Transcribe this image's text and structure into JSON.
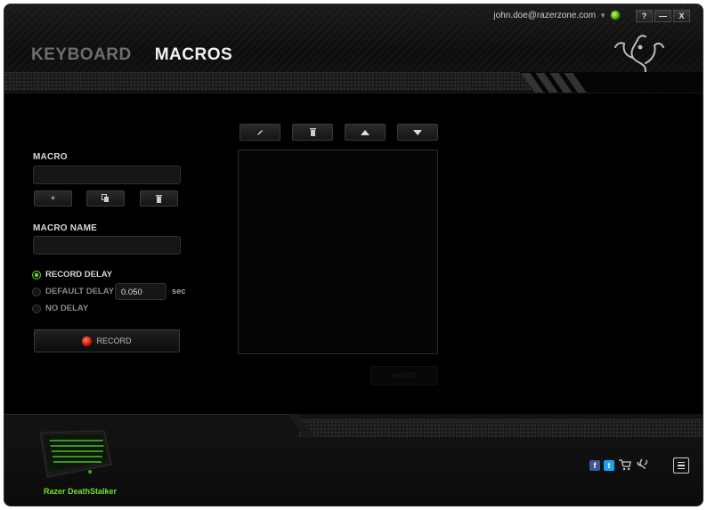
{
  "account": {
    "email": "john.doe@razerzone.com",
    "dropdown_icon": "triangle-down-icon",
    "status_color": "#44c800"
  },
  "window_controls": {
    "help": "?",
    "minimize": "—",
    "close": "X"
  },
  "tabs": [
    {
      "label": "KEYBOARD",
      "active": false
    },
    {
      "label": "MACROS",
      "active": true
    }
  ],
  "macro_panel": {
    "macro_label": "MACRO",
    "macro_value": "",
    "add_button": "+",
    "copy_icon": "copy-icon",
    "delete_icon": "trash-icon",
    "macro_name_label": "MACRO NAME",
    "macro_name_value": ""
  },
  "delay": {
    "options": [
      {
        "label": "RECORD DELAY",
        "selected": true
      },
      {
        "label": "DEFAULT DELAY",
        "selected": false
      },
      {
        "label": "NO DELAY",
        "selected": false
      }
    ],
    "default_delay_value": "0.050",
    "unit": "sec"
  },
  "record_button": {
    "label": "RECORD",
    "icon": "record-dot-icon"
  },
  "editor_toolbar": {
    "edit_icon": "pencil-icon",
    "delete_icon": "trash-icon",
    "up_icon": "triangle-up-icon",
    "down_icon": "triangle-down-icon"
  },
  "insert_button": {
    "label": "INSERT"
  },
  "footer": {
    "device_name": "Razer DeathStalker",
    "social": {
      "facebook": "f",
      "twitter": "t"
    }
  },
  "colors": {
    "accent_green": "#6fe02a",
    "background": "#000000",
    "record_red": "#d61200"
  }
}
